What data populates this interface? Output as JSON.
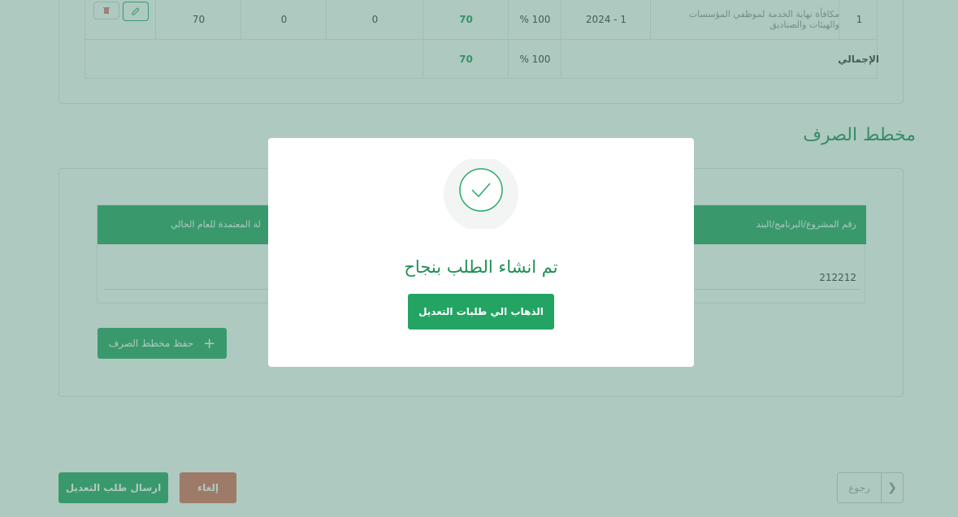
{
  "summary_table": {
    "row": {
      "index": "1",
      "description_line1": "مكافأة نهاية الخدمة لموظفي المؤسسات",
      "description_line2": "والهيئات والصناديق",
      "period": "2024 - 1",
      "percent": "% 100",
      "amount": "70",
      "col_a": "0",
      "col_b": "0",
      "col_c": "70",
      "edit_icon": "pencil-icon",
      "delete_icon": "trash-icon"
    },
    "total": {
      "label": "الإجمالي",
      "percent": "% 100",
      "amount": "70"
    }
  },
  "spending_plan": {
    "title": "مخطط الصرف",
    "headers": {
      "project_number": "رقم المشروع/البرنامج/البند",
      "approved_amount": "لة المعتمدة للعام الحالي"
    },
    "row": {
      "project_number": "212212"
    },
    "save_button_label": "حفظ مخطط الصرف",
    "save_button_icon": "plus-icon"
  },
  "footer": {
    "submit_label": "ارسال طلب التعديل",
    "cancel_label": "إلغاء",
    "back_label": "رجوع",
    "back_icon": "chevron-right-icon"
  },
  "modal": {
    "icon": "check-circle-icon",
    "message": "تم انشاء الطلب بنجاح",
    "button_label": "الذهاب الي طلبات التعديل"
  },
  "colors": {
    "primary_green": "#23a463",
    "danger": "#e06b5c",
    "overlay": "#528c7a"
  }
}
